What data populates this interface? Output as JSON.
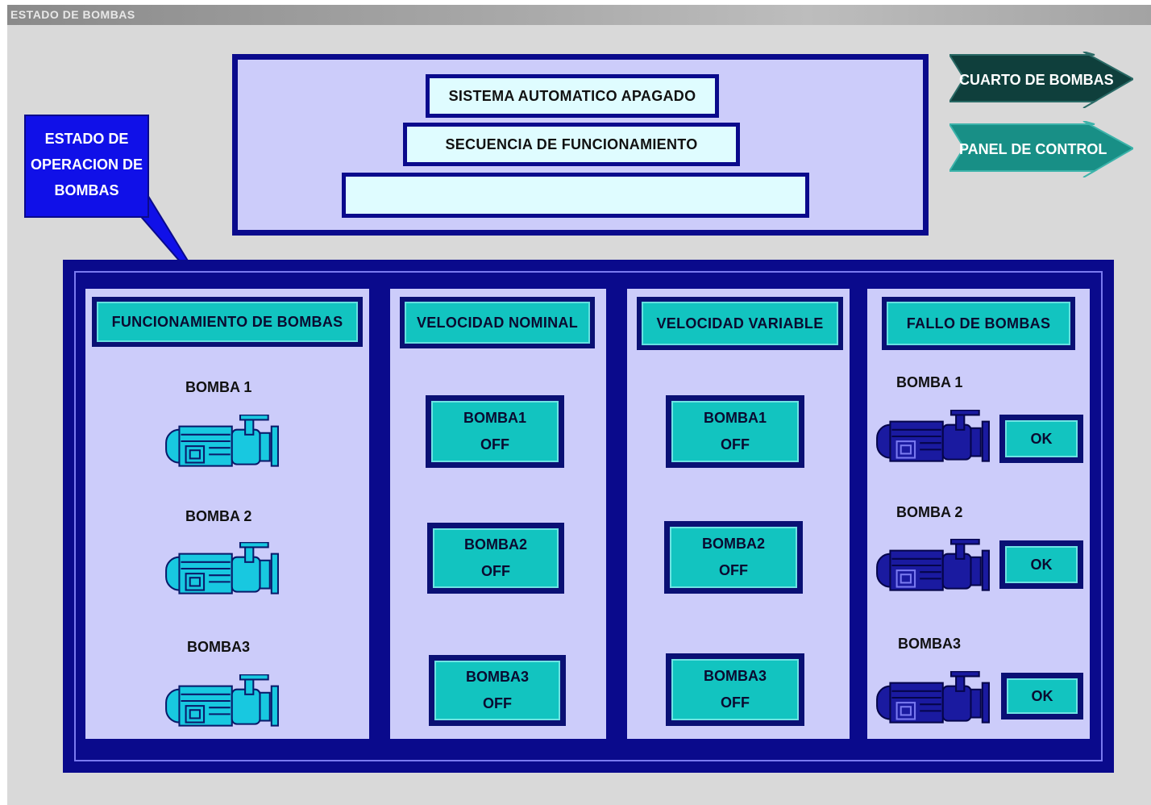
{
  "window": {
    "title": "ESTADO DE BOMBAS"
  },
  "callout": {
    "line1": "ESTADO DE",
    "line2": "OPERACION DE",
    "line3": "BOMBAS"
  },
  "status": {
    "system_label": "SISTEMA AUTOMATICO APAGADO",
    "sequence_label": "SECUENCIA DE FUNCIONAMIENTO",
    "sequence_value": ""
  },
  "nav": {
    "pump_room": "CUARTO DE BOMBAS",
    "control_panel": "PANEL DE CONTROL"
  },
  "panels": {
    "operation": {
      "header": "FUNCIONAMIENTO DE BOMBAS",
      "pumps": [
        "BOMBA 1",
        "BOMBA 2",
        "BOMBA3"
      ]
    },
    "nominal": {
      "header": "VELOCIDAD NOMINAL",
      "buttons": [
        {
          "name": "BOMBA1",
          "state": "OFF"
        },
        {
          "name": "BOMBA2",
          "state": "OFF"
        },
        {
          "name": "BOMBA3",
          "state": "OFF"
        }
      ]
    },
    "variable": {
      "header": "VELOCIDAD VARIABLE",
      "buttons": [
        {
          "name": "BOMBA1",
          "state": "OFF"
        },
        {
          "name": "BOMBA2",
          "state": "OFF"
        },
        {
          "name": "BOMBA3",
          "state": "OFF"
        }
      ]
    },
    "fault": {
      "header": "FALLO DE BOMBAS",
      "pumps": [
        {
          "name": "BOMBA 1",
          "status": "OK"
        },
        {
          "name": "BOMBA 2",
          "status": "OK"
        },
        {
          "name": "BOMBA3",
          "status": "OK"
        }
      ]
    }
  },
  "colors": {
    "navy": "#0a0a8c",
    "panel_fill": "#ccccfa",
    "teal": "#12c4c0",
    "pump_cyan": "#18c8e0",
    "pump_navy": "#1a1aa0",
    "arrow_dark": "#0f3f3c",
    "arrow_teal": "#188f86"
  }
}
